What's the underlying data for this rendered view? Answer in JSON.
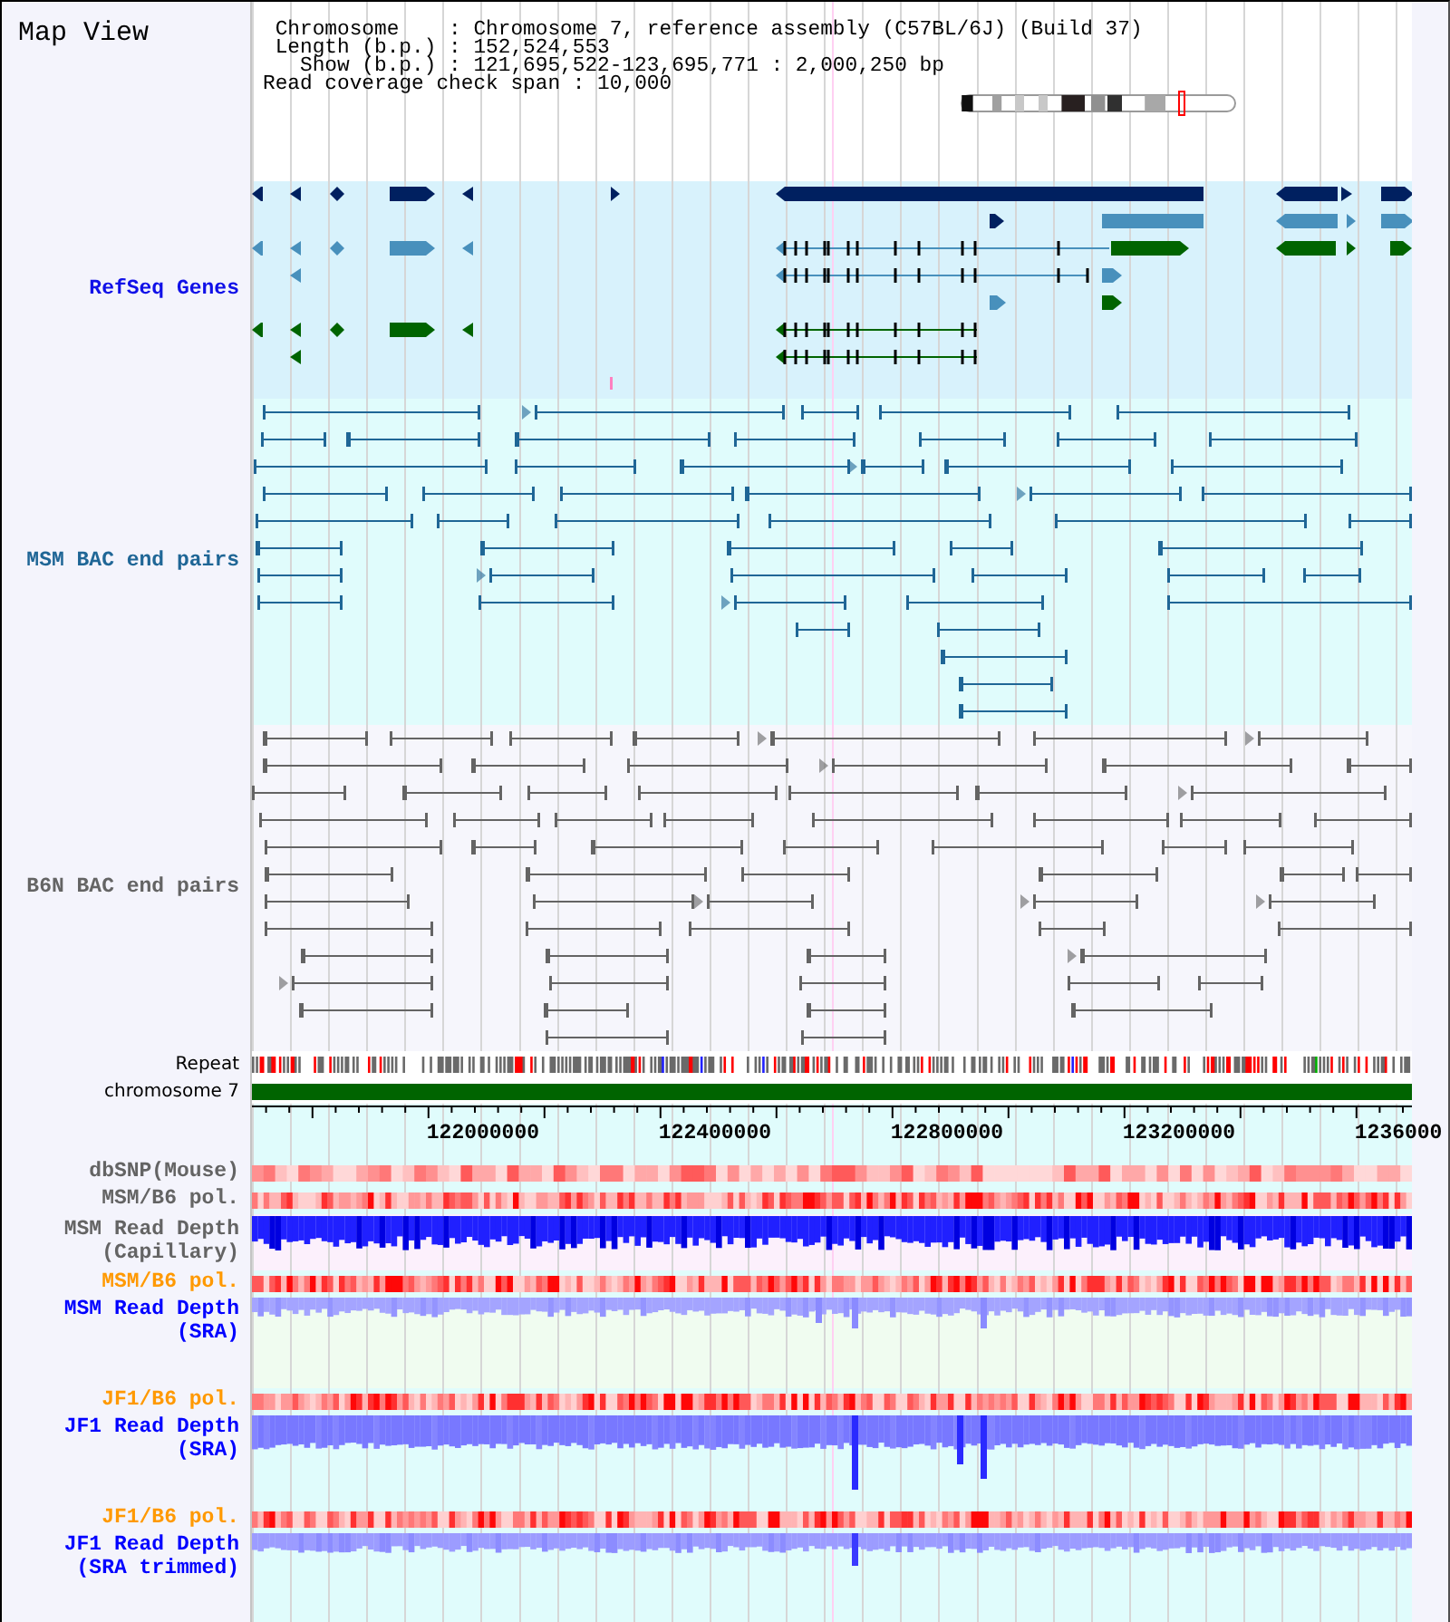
{
  "title": "Map View",
  "summary_lines": [
    "Chromosome    : Chromosome 7, reference assembly (C57BL/6J) (Build 37)",
    "Length (b.p.) : 152,524,553",
    "Show (b.p.) : 121,695,522-123,695,771 : 2,000,250 bp",
    "Read coverage check span : 10,000"
  ],
  "tracks": [
    {
      "kind": "genes",
      "label": [
        "RefSeq Genes"
      ],
      "color": "#1010e8"
    },
    {
      "kind": "pairs",
      "label": [
        "MSM BAC end pairs"
      ],
      "color": "#1f6696"
    },
    {
      "kind": "pairs",
      "label": [
        "B6N BAC end pairs"
      ],
      "color": "#646464"
    },
    {
      "kind": "repeat",
      "label": [
        "Repeat"
      ]
    },
    {
      "kind": "chromosome",
      "label": [
        "chromosome 7"
      ]
    },
    {
      "kind": "ruler",
      "ticks": [
        "122000000",
        "122400000",
        "122800000",
        "123200000",
        "1236000"
      ]
    },
    {
      "kind": "heatmap",
      "label": [
        "dbSNP(Mouse)"
      ],
      "color": "#646464"
    },
    {
      "kind": "heatmap",
      "label": [
        "MSM/B6 pol."
      ],
      "color": "#646464"
    },
    {
      "kind": "capillary",
      "label": [
        "MSM Read Depth",
        "(Capillary)"
      ],
      "color": "#646464"
    },
    {
      "kind": "heatmap",
      "label": [
        "MSM/B6 pol."
      ],
      "color": "#ff9900"
    },
    {
      "kind": "sra",
      "label": [
        "MSM Read Depth",
        "(SRA)"
      ],
      "color": "#0000ff"
    },
    {
      "kind": "heatmap",
      "label": [
        "JF1/B6 pol."
      ],
      "color": "#ff9900"
    },
    {
      "kind": "sra",
      "label": [
        "JF1 Read Depth",
        "(SRA)"
      ],
      "color": "#0000ff"
    },
    {
      "kind": "heatmap",
      "label": [
        "JF1/B6 pol."
      ],
      "color": "#ff9900"
    },
    {
      "kind": "sra",
      "label": [
        "JF1 Read Depth",
        "(SRA trimmed)"
      ],
      "color": "#0000ff"
    }
  ]
}
